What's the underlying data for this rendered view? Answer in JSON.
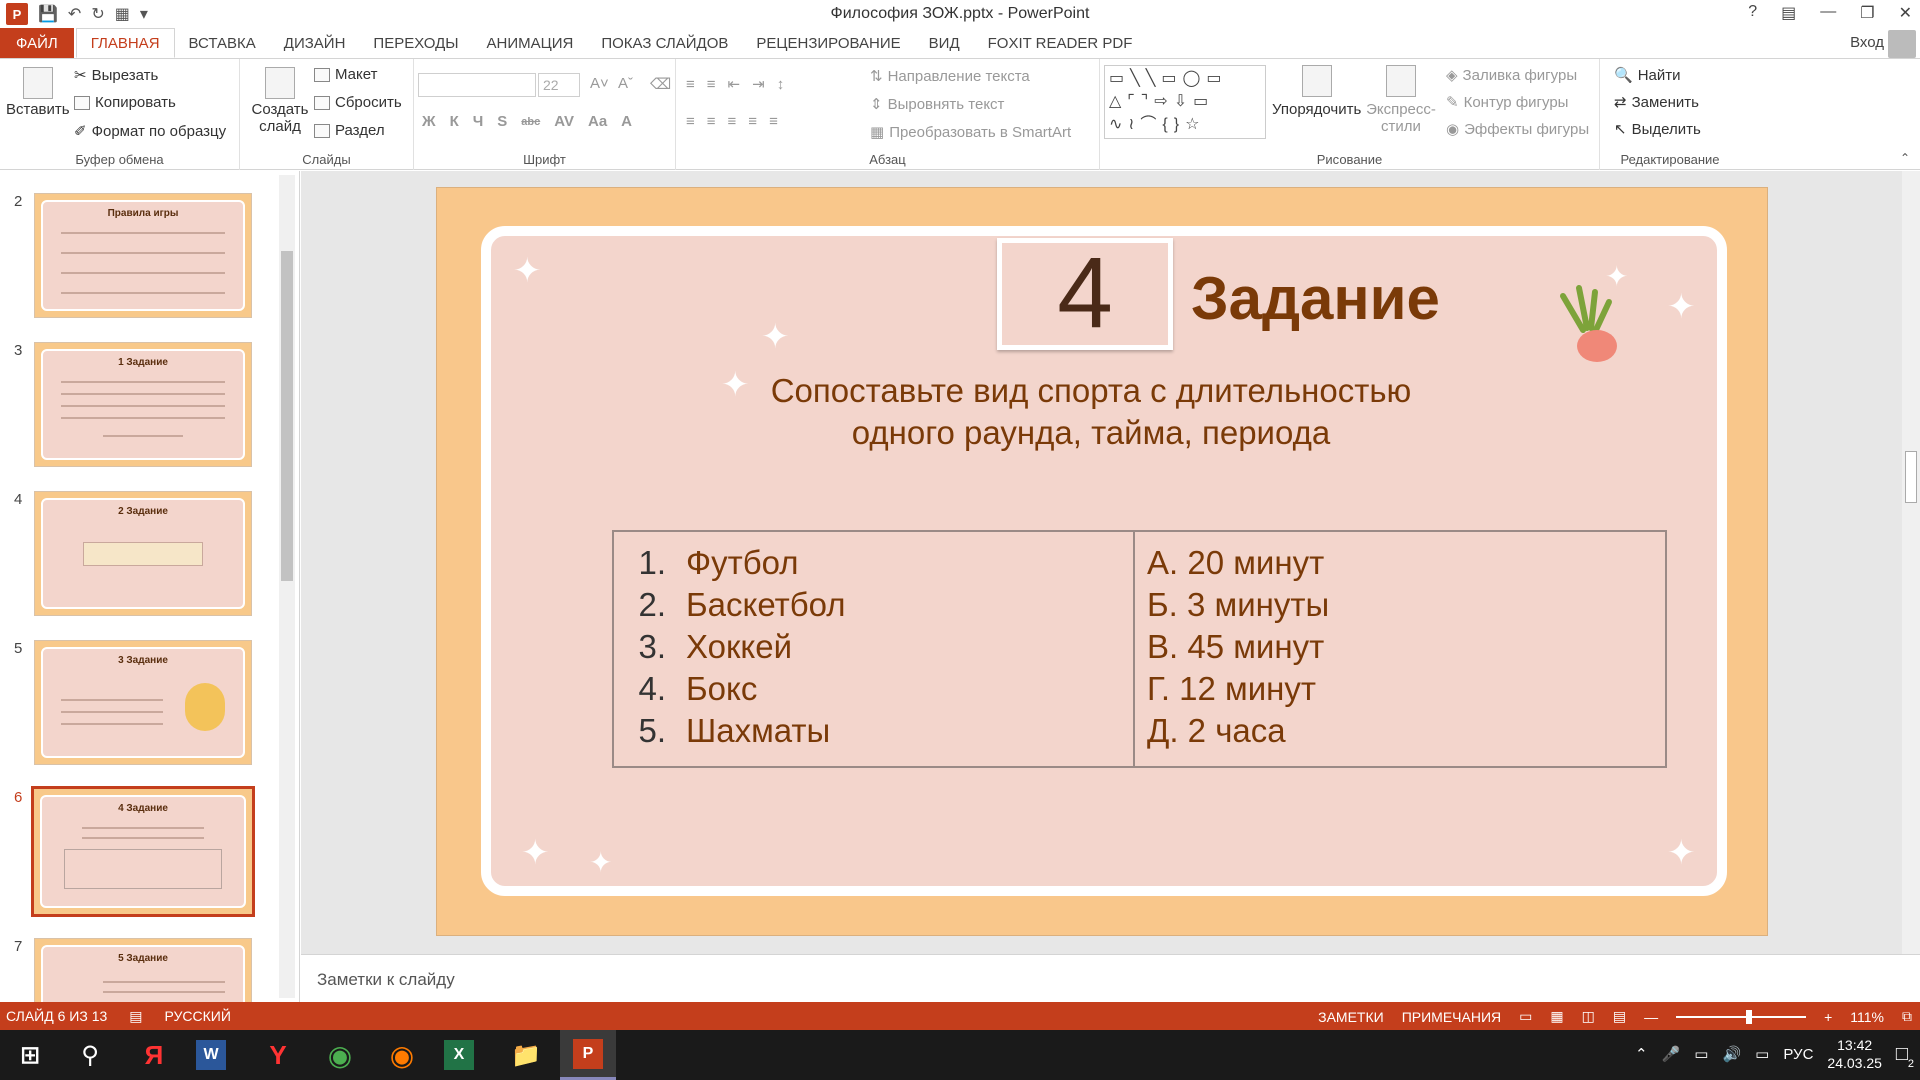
{
  "window": {
    "title": "Философия ЗОЖ.pptx - PowerPoint",
    "help": "?",
    "signin": "Вход"
  },
  "tabs": [
    "ФАЙЛ",
    "ГЛАВНАЯ",
    "ВСТАВКА",
    "ДИЗАЙН",
    "ПЕРЕХОДЫ",
    "АНИМАЦИЯ",
    "ПОКАЗ СЛАЙДОВ",
    "РЕЦЕНЗИРОВАНИЕ",
    "ВИД",
    "FOXIT READER PDF"
  ],
  "ribbon": {
    "clipboard": {
      "label": "Буфер обмена",
      "paste": "Вставить",
      "cut": "Вырезать",
      "copy": "Копировать",
      "format": "Формат по образцу"
    },
    "slides": {
      "label": "Слайды",
      "new": "Создать слайд",
      "layout": "Макет",
      "reset": "Сбросить",
      "section": "Раздел"
    },
    "font": {
      "label": "Шрифт",
      "size": "22",
      "b": "Ж",
      "i": "К",
      "u": "Ч",
      "s": "S",
      "abc": "abc",
      "av": "AV",
      "aa": "Aa",
      "a": "A"
    },
    "paragraph": {
      "label": "Абзац",
      "dir": "Направление текста",
      "align": "Выровнять текст",
      "smart": "Преобразовать в SmartArt"
    },
    "drawing": {
      "label": "Рисование",
      "arrange": "Упорядочить",
      "styles": "Экспресс-стили",
      "fill": "Заливка фигуры",
      "outline": "Контур фигуры",
      "effects": "Эффекты фигуры"
    },
    "editing": {
      "label": "Редактирование",
      "find": "Найти",
      "replace": "Заменить",
      "select": "Выделить"
    }
  },
  "thumbnails": [
    {
      "num": "2",
      "title": "Правила игры"
    },
    {
      "num": "3",
      "title": "1  Задание"
    },
    {
      "num": "4",
      "title": "2  Задание"
    },
    {
      "num": "5",
      "title": "3  Задание"
    },
    {
      "num": "6",
      "title": "4  Задание"
    },
    {
      "num": "7",
      "title": "5  Задание"
    }
  ],
  "slide": {
    "number": "4",
    "heading": "Задание",
    "question": "Сопоставьте вид спорта с длительностью одного раунда, тайма, периода",
    "left": [
      {
        "n": "1.",
        "t": "Футбол"
      },
      {
        "n": "2.",
        "t": "Баскетбол"
      },
      {
        "n": "3.",
        "t": "Хоккей"
      },
      {
        "n": "4.",
        "t": "Бокс"
      },
      {
        "n": "5.",
        "t": "Шахматы"
      }
    ],
    "right": [
      "А. 20 минут",
      "Б. 3 минуты",
      "В. 45 минут",
      "Г. 12 минут",
      "Д. 2 часа"
    ]
  },
  "notes": "Заметки к слайду",
  "status": {
    "slide": "СЛАЙД 6 ИЗ 13",
    "lang": "РУССКИЙ",
    "notes": "ЗАМЕТКИ",
    "comments": "ПРИМЕЧАНИЯ",
    "zoom": "111%"
  },
  "taskbar": {
    "lang": "РУС",
    "time": "13:42",
    "date": "24.03.25",
    "notif": "2"
  }
}
